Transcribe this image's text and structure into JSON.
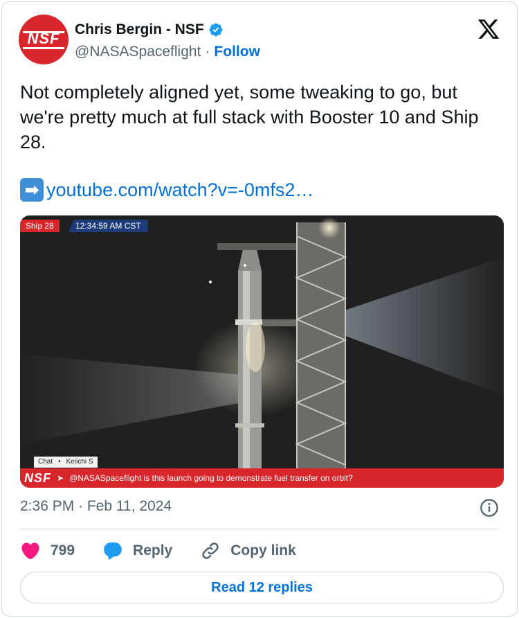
{
  "author": {
    "display_name": "Chris Bergin - NSF",
    "handle": "@NASASpaceflight",
    "separator": "·",
    "follow_label": "Follow",
    "avatar_text": "NSF"
  },
  "tweet": {
    "text": "Not completely aligned yet, some tweaking to go, but we're pretty much at full stack with Booster 10 and Ship 28.",
    "link_emoji": "➡",
    "link_text": "youtube.com/watch?v=-0mfs2…"
  },
  "media": {
    "label_ship": "Ship 28",
    "label_time": "12:34:59 AM CST",
    "chat_label": "Chat",
    "chat_dot": "•",
    "chat_user": "Keiichi S",
    "chat_logo": "NSF",
    "chat_arrow": "➤",
    "chat_message": "@NASASpaceflight is this launch going to demonstrate fuel transfer on orbit?"
  },
  "timestamp": "2:36 PM · Feb 11, 2024",
  "actions": {
    "like_count": "799",
    "reply_label": "Reply",
    "copy_label": "Copy link"
  },
  "read_replies_label": "Read 12 replies",
  "colors": {
    "link_blue": "#006fd6",
    "like_pink": "#f91880",
    "nsf_red": "#d7262c",
    "muted_text": "#536471"
  },
  "icons": [
    "verified-badge-icon",
    "x-logo-icon",
    "arrow-right-emoji-icon",
    "info-icon",
    "heart-icon",
    "reply-bubble-icon",
    "link-icon"
  ]
}
